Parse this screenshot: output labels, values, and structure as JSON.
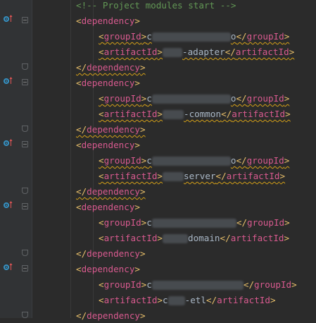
{
  "editor": {
    "top_line": "<!-- Project modules start -->",
    "dependencies": [
      {
        "groupId": "c████████████o",
        "artifactId": "███-adapter",
        "warn": true
      },
      {
        "groupId": "c████████████o",
        "artifactId": "███-common",
        "warn": true
      },
      {
        "groupId": "c████████████o",
        "artifactId": "███server",
        "warn": true
      },
      {
        "groupId": "c████████████",
        "artifactId": "████domain",
        "warn": false
      },
      {
        "groupId": "c██████████████",
        "artifactId": "c██-etl",
        "warn": false
      }
    ],
    "tags": {
      "dependency": "dependency",
      "groupId": "groupId",
      "artifactId": "artifactId"
    }
  },
  "gutter": {
    "icon": "maven-dependency-navigate-icon",
    "fold_icon": "fold-marker-icon"
  },
  "colors": {
    "background": "#2b2b2b",
    "gutter": "#313335",
    "tag": "#e8bf6a",
    "text": "#a9b7c6",
    "icon_blue": "#3592c4",
    "icon_red": "#e05555",
    "warning_squiggle": "#d4a017"
  }
}
